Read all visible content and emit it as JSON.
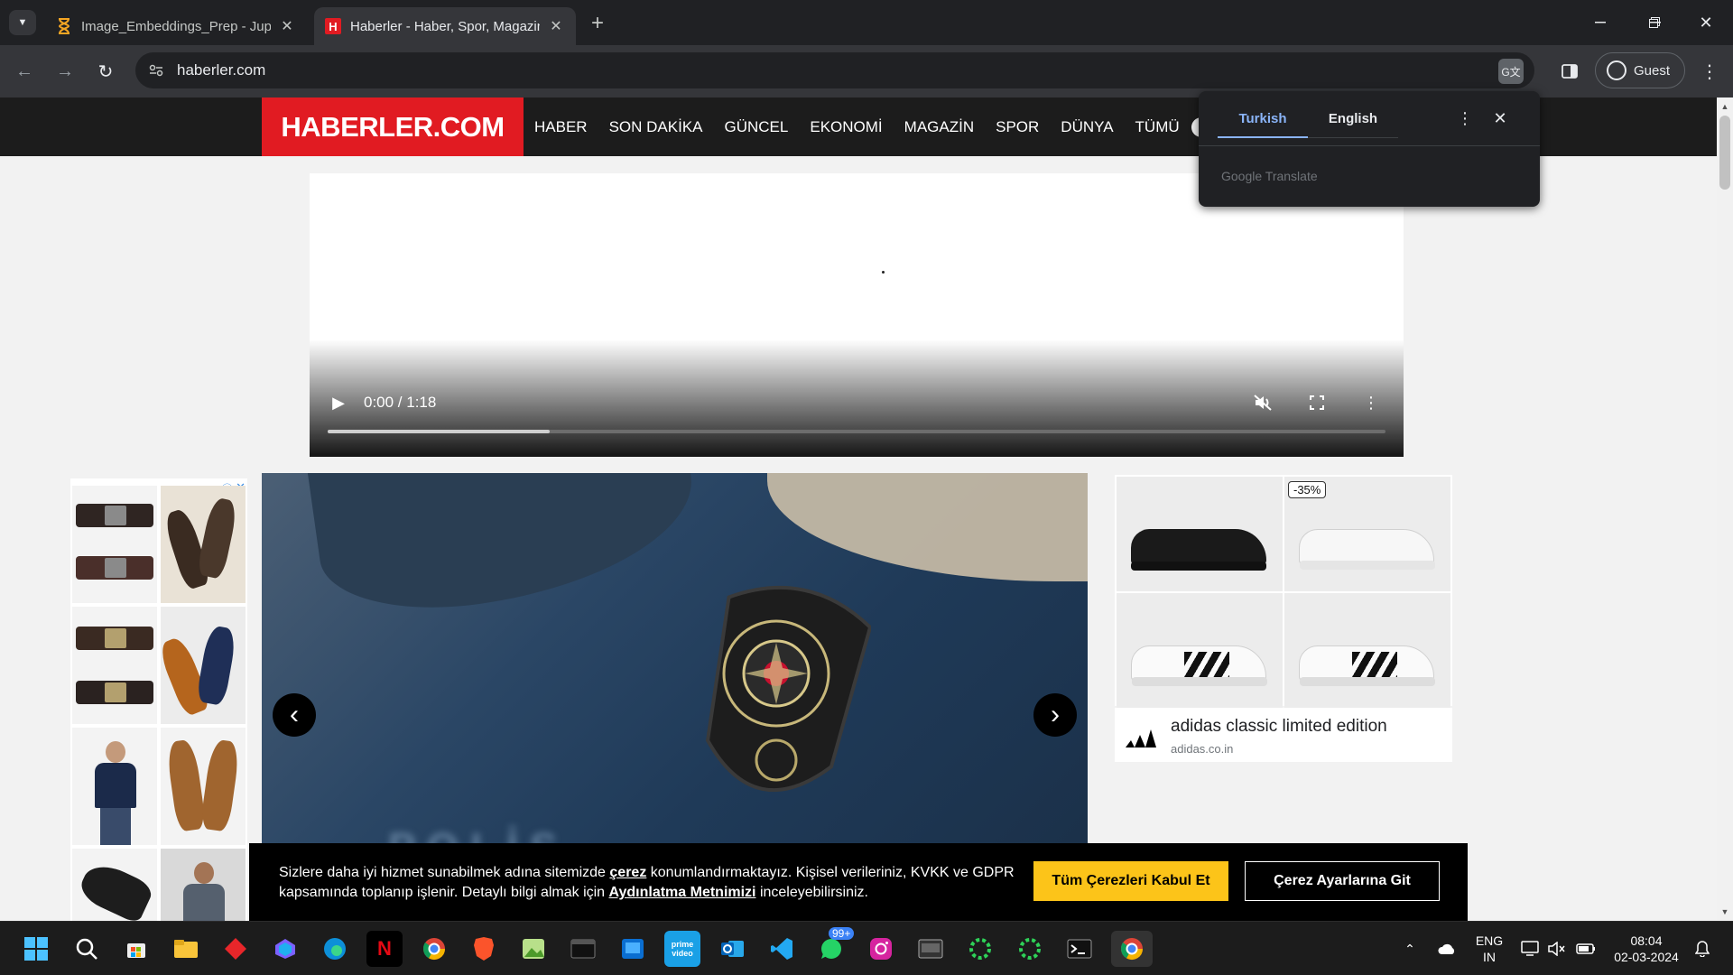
{
  "browser": {
    "tabs": [
      {
        "title": "Image_Embeddings_Prep - Jupyter",
        "favicon": "hourglass-icon",
        "active": false
      },
      {
        "title": "Haberler - Haber, Spor, Magazin",
        "favicon": "H",
        "active": true
      }
    ],
    "url": "haberler.com",
    "profile_label": "Guest"
  },
  "site": {
    "logo": "HABERLER.COM",
    "brand_color": "#e11b22",
    "nav": [
      "HABER",
      "SON DAKİKA",
      "GÜNCEL",
      "EKONOMİ",
      "MAGAZİN",
      "SPOR",
      "DÜNYA",
      "TÜMÜ"
    ]
  },
  "video": {
    "time": "0:00 / 1:18",
    "buffered_fraction": 0.21
  },
  "right_ad": {
    "discount": "-35%",
    "title": "adidas classic limited edition",
    "domain": "adidas.co.in"
  },
  "cookie": {
    "text_1": "Sizlere daha iyi hizmet sunabilmek adına sitemizde ",
    "link_1": "çerez",
    "text_2": " konumlandırmaktayız. Kişisel verileriniz, KVKK ve GDPR kapsamında toplanıp işlenir. Detaylı bilgi almak için ",
    "link_2": "Aydınlatma Metnimizi",
    "text_3": " inceleyebilirsiniz.",
    "accept_label": "Tüm Çerezleri Kabul Et",
    "settings_label": "Çerez Ayarlarına Git",
    "accept_color": "#fcc419"
  },
  "translate": {
    "languages": [
      "Turkish",
      "English"
    ],
    "selected": "Turkish",
    "powered_by": "Google Translate"
  },
  "taskbar": {
    "badge": "99+",
    "lang_line1": "ENG",
    "lang_line2": "IN",
    "time": "08:04",
    "date": "02-03-2024"
  }
}
